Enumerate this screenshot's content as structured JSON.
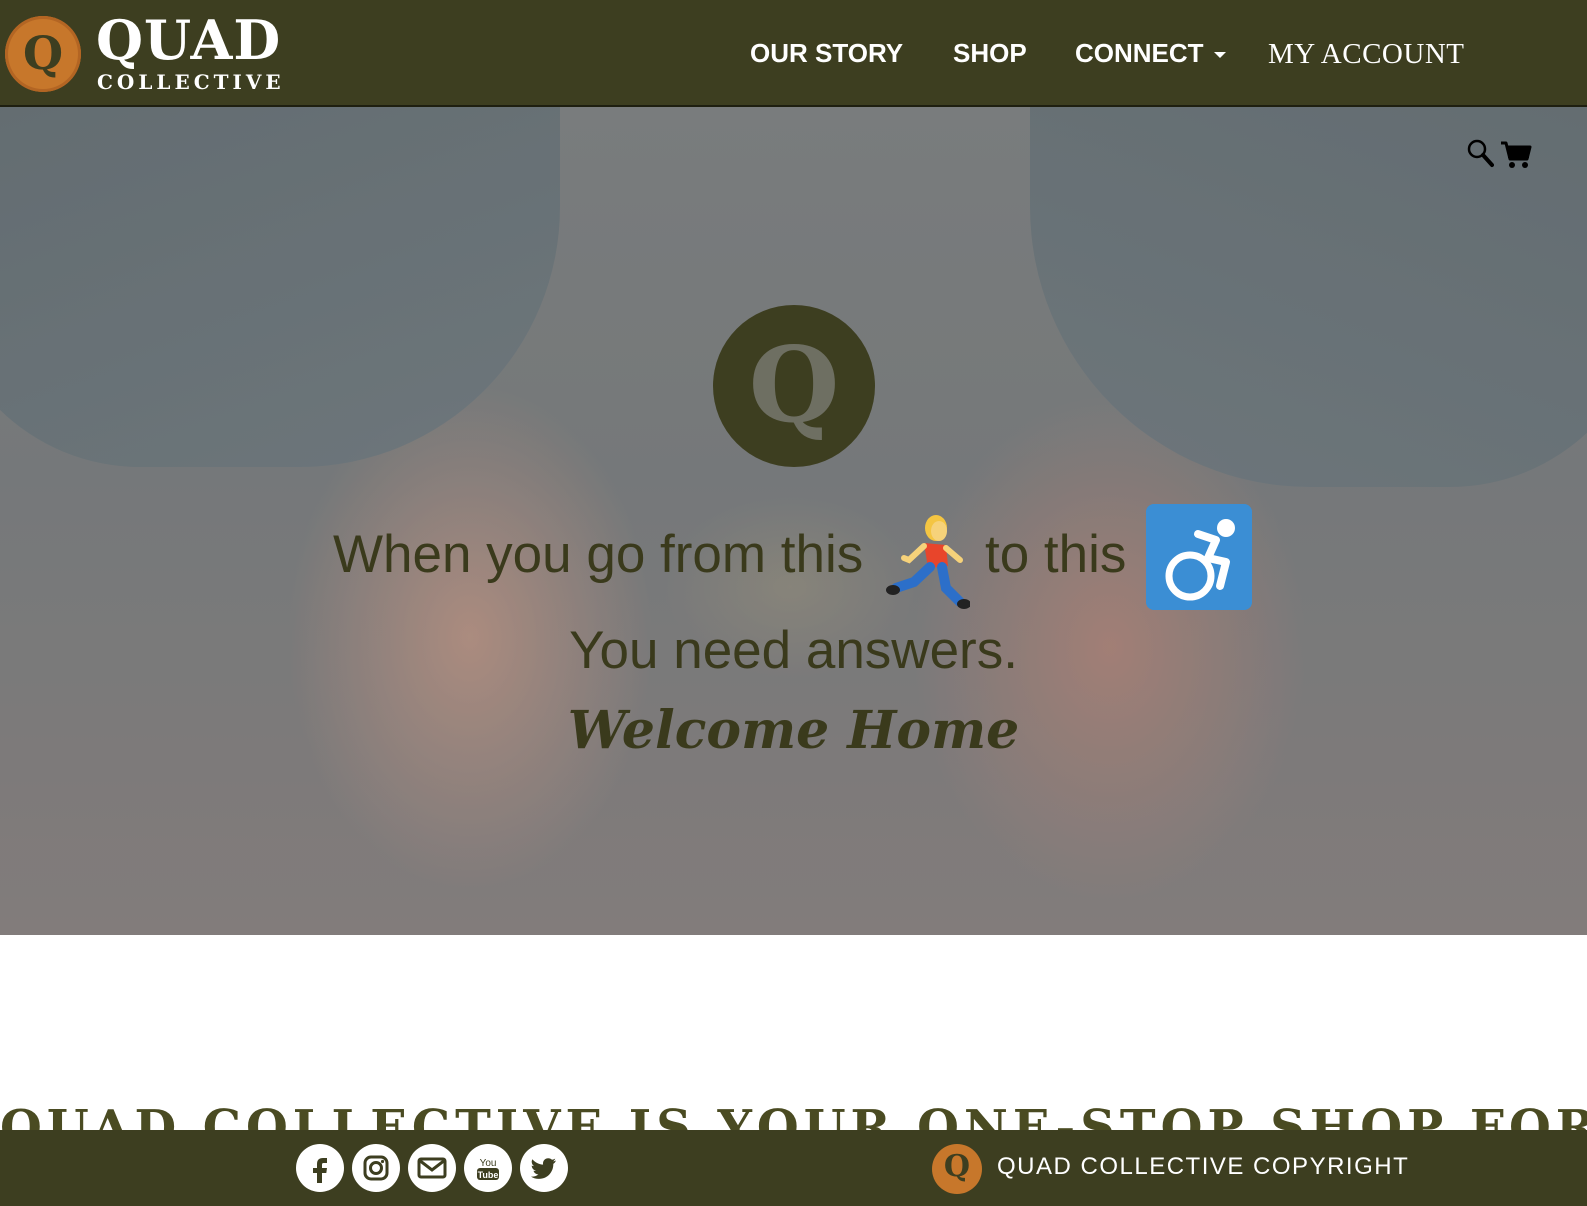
{
  "brand": {
    "logo_letter": "Q",
    "name": "QUAD",
    "sub": "COLLECTIVE",
    "colors": {
      "primary": "#3d3e20",
      "accent": "#c7772b",
      "hero_text": "#3a3a1c"
    }
  },
  "nav": {
    "items": [
      {
        "label": "OUR STORY"
      },
      {
        "label": "SHOP"
      },
      {
        "label": "CONNECT",
        "has_dropdown": true
      },
      {
        "label": "MY ACCOUNT"
      }
    ]
  },
  "hero": {
    "tools": {
      "search_icon": "search-icon",
      "cart_icon": "cart-icon"
    },
    "badge_letter": "Q",
    "line1_part1": "When you go from this",
    "line1_emoji1": "runner-icon",
    "line1_part2": "to this",
    "line1_emoji2": "wheelchair-icon",
    "line2": "You need answers.",
    "line3": "Welcome Home"
  },
  "section": {
    "tagline": "QUAD COLLECTIVE IS YOUR ONE-STOP SHOP FOR"
  },
  "footer": {
    "social": [
      "facebook-icon",
      "instagram-icon",
      "email-icon",
      "youtube-icon",
      "twitter-icon"
    ],
    "badge_letter": "Q",
    "copyright": "QUAD COLLECTIVE COPYRIGHT"
  }
}
